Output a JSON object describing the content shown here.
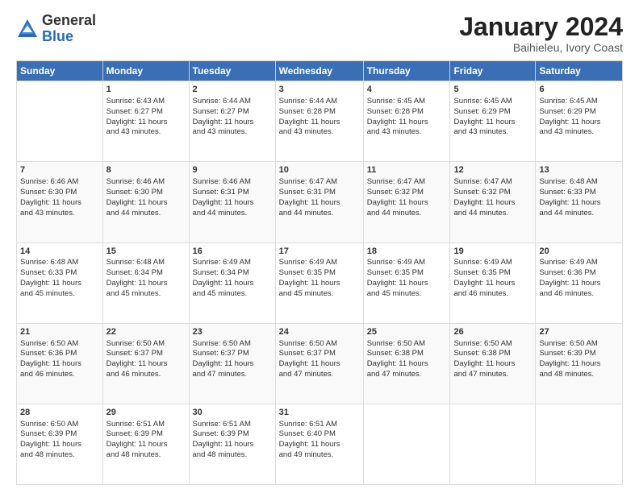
{
  "logo": {
    "line1": "General",
    "line2": "Blue"
  },
  "title": "January 2024",
  "location": "Baihieleu, Ivory Coast",
  "days_header": [
    "Sunday",
    "Monday",
    "Tuesday",
    "Wednesday",
    "Thursday",
    "Friday",
    "Saturday"
  ],
  "weeks": [
    [
      {
        "day": "",
        "info": ""
      },
      {
        "day": "1",
        "info": "Sunrise: 6:43 AM\nSunset: 6:27 PM\nDaylight: 11 hours\nand 43 minutes."
      },
      {
        "day": "2",
        "info": "Sunrise: 6:44 AM\nSunset: 6:27 PM\nDaylight: 11 hours\nand 43 minutes."
      },
      {
        "day": "3",
        "info": "Sunrise: 6:44 AM\nSunset: 6:28 PM\nDaylight: 11 hours\nand 43 minutes."
      },
      {
        "day": "4",
        "info": "Sunrise: 6:45 AM\nSunset: 6:28 PM\nDaylight: 11 hours\nand 43 minutes."
      },
      {
        "day": "5",
        "info": "Sunrise: 6:45 AM\nSunset: 6:29 PM\nDaylight: 11 hours\nand 43 minutes."
      },
      {
        "day": "6",
        "info": "Sunrise: 6:45 AM\nSunset: 6:29 PM\nDaylight: 11 hours\nand 43 minutes."
      }
    ],
    [
      {
        "day": "7",
        "info": "Sunrise: 6:46 AM\nSunset: 6:30 PM\nDaylight: 11 hours\nand 43 minutes."
      },
      {
        "day": "8",
        "info": "Sunrise: 6:46 AM\nSunset: 6:30 PM\nDaylight: 11 hours\nand 44 minutes."
      },
      {
        "day": "9",
        "info": "Sunrise: 6:46 AM\nSunset: 6:31 PM\nDaylight: 11 hours\nand 44 minutes."
      },
      {
        "day": "10",
        "info": "Sunrise: 6:47 AM\nSunset: 6:31 PM\nDaylight: 11 hours\nand 44 minutes."
      },
      {
        "day": "11",
        "info": "Sunrise: 6:47 AM\nSunset: 6:32 PM\nDaylight: 11 hours\nand 44 minutes."
      },
      {
        "day": "12",
        "info": "Sunrise: 6:47 AM\nSunset: 6:32 PM\nDaylight: 11 hours\nand 44 minutes."
      },
      {
        "day": "13",
        "info": "Sunrise: 6:48 AM\nSunset: 6:33 PM\nDaylight: 11 hours\nand 44 minutes."
      }
    ],
    [
      {
        "day": "14",
        "info": "Sunrise: 6:48 AM\nSunset: 6:33 PM\nDaylight: 11 hours\nand 45 minutes."
      },
      {
        "day": "15",
        "info": "Sunrise: 6:48 AM\nSunset: 6:34 PM\nDaylight: 11 hours\nand 45 minutes."
      },
      {
        "day": "16",
        "info": "Sunrise: 6:49 AM\nSunset: 6:34 PM\nDaylight: 11 hours\nand 45 minutes."
      },
      {
        "day": "17",
        "info": "Sunrise: 6:49 AM\nSunset: 6:35 PM\nDaylight: 11 hours\nand 45 minutes."
      },
      {
        "day": "18",
        "info": "Sunrise: 6:49 AM\nSunset: 6:35 PM\nDaylight: 11 hours\nand 45 minutes."
      },
      {
        "day": "19",
        "info": "Sunrise: 6:49 AM\nSunset: 6:35 PM\nDaylight: 11 hours\nand 46 minutes."
      },
      {
        "day": "20",
        "info": "Sunrise: 6:49 AM\nSunset: 6:36 PM\nDaylight: 11 hours\nand 46 minutes."
      }
    ],
    [
      {
        "day": "21",
        "info": "Sunrise: 6:50 AM\nSunset: 6:36 PM\nDaylight: 11 hours\nand 46 minutes."
      },
      {
        "day": "22",
        "info": "Sunrise: 6:50 AM\nSunset: 6:37 PM\nDaylight: 11 hours\nand 46 minutes."
      },
      {
        "day": "23",
        "info": "Sunrise: 6:50 AM\nSunset: 6:37 PM\nDaylight: 11 hours\nand 47 minutes."
      },
      {
        "day": "24",
        "info": "Sunrise: 6:50 AM\nSunset: 6:37 PM\nDaylight: 11 hours\nand 47 minutes."
      },
      {
        "day": "25",
        "info": "Sunrise: 6:50 AM\nSunset: 6:38 PM\nDaylight: 11 hours\nand 47 minutes."
      },
      {
        "day": "26",
        "info": "Sunrise: 6:50 AM\nSunset: 6:38 PM\nDaylight: 11 hours\nand 47 minutes."
      },
      {
        "day": "27",
        "info": "Sunrise: 6:50 AM\nSunset: 6:39 PM\nDaylight: 11 hours\nand 48 minutes."
      }
    ],
    [
      {
        "day": "28",
        "info": "Sunrise: 6:50 AM\nSunset: 6:39 PM\nDaylight: 11 hours\nand 48 minutes."
      },
      {
        "day": "29",
        "info": "Sunrise: 6:51 AM\nSunset: 6:39 PM\nDaylight: 11 hours\nand 48 minutes."
      },
      {
        "day": "30",
        "info": "Sunrise: 6:51 AM\nSunset: 6:39 PM\nDaylight: 11 hours\nand 48 minutes."
      },
      {
        "day": "31",
        "info": "Sunrise: 6:51 AM\nSunset: 6:40 PM\nDaylight: 11 hours\nand 49 minutes."
      },
      {
        "day": "",
        "info": ""
      },
      {
        "day": "",
        "info": ""
      },
      {
        "day": "",
        "info": ""
      }
    ]
  ]
}
